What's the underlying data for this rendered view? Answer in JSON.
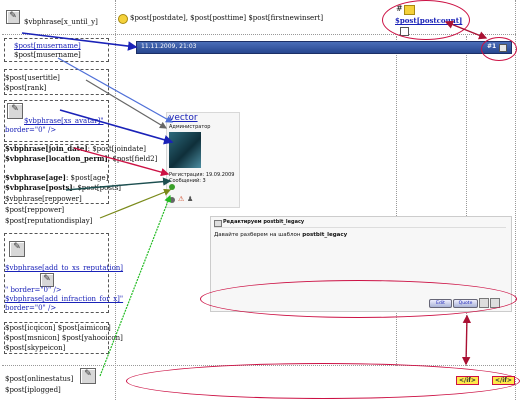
{
  "colors": {
    "accent_red": "#cc1144",
    "link_blue": "#1a22b8",
    "header_blue": "#2e4f9a",
    "yellow": "#ffe94a"
  },
  "icons": [
    "broken-image-icon",
    "yellow-smiley-icon",
    "closed-envelope-icon",
    "checkbox"
  ],
  "top": {
    "until": "$vbphrase[x_until_y]",
    "datetime": "$post[postdate], $post[posttime] $post[firstnewinsert]",
    "hash": "#",
    "postcount": "$post[postcount]"
  },
  "left": {
    "musername_1": "$post[musername]",
    "musername_2": "$post[musername]",
    "usertitle": "$post[usertitle]",
    "rank": "$post[rank]",
    "avatar_phrase": "$vbphrase[xs_avatar]\"",
    "avatar_border": "border=\"0\" />",
    "join_date_label": "$vbphrase[join_date]",
    "join_date_value": ": $post[joindate]",
    "location_label": "$vbphrase[location_perm]",
    "location_value": ": $post[field2]",
    "age_label": "$vbphrase[age]",
    "age_value": ": $post[age]",
    "posts_label": "$vbphrase[posts]",
    "posts_value": ": $post[posts]",
    "reppower_phrase": "$vbphrase[reppower]",
    "reppower": "$post[reppower]",
    "repdisplay": "$post[reputationdisplay]",
    "add_rep": "$vbphrase[add_to_xs_reputation]",
    "add_rep_border": "\" border=\"0\" />",
    "add_infraction": "$vbphrase[add_infraction_for_x]\"",
    "infraction_border": "border=\"0\" />",
    "im_line_1": "$post[icqicon] $post[aimicon]",
    "im_line_2": "$post[msnicon] $post[yahooicon]",
    "im_line_3": "$post[skypeicon]",
    "onlinestatus": "$post[onlinestatus]",
    "iplogged": "$post[iplogged]"
  },
  "header_bar": {
    "date": "11.11.2009, 21:03",
    "post_number": "#1"
  },
  "profile_card": {
    "username": "vector",
    "title": "Администратор",
    "reg_label": "Регистрация:",
    "reg_value": "19.09.2009",
    "posts_label": "Сообщений:",
    "posts_value": "3"
  },
  "message_box": {
    "title": "Редактируем postbit_legacy",
    "body_prefix": "Давайте разберем на шаблон",
    "body_strong": "postbit_legacy",
    "edit_btn": "Edit",
    "quote_btn": "Quote"
  },
  "footer": {
    "if_tag_1": "</if>",
    "if_tag_2": "</if>"
  }
}
